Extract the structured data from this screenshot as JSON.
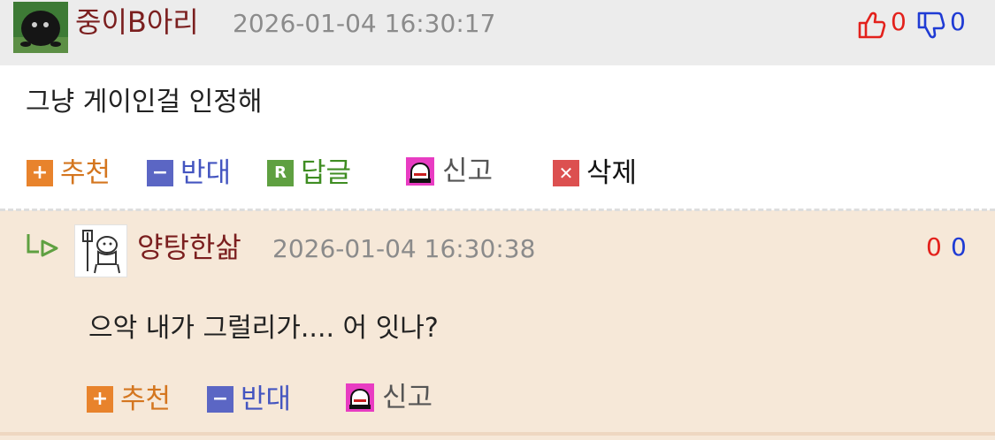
{
  "comment": {
    "username": "중이B아리",
    "timestamp": "2026-01-04 16:30:17",
    "up_count": "0",
    "down_count": "0",
    "text": "그냥 게이인걸 인정해",
    "actions": {
      "recommend": "추천",
      "oppose": "반대",
      "reply": "답글",
      "report": "신고",
      "delete": "삭제"
    },
    "icons": {
      "recommend": "plus-icon",
      "oppose": "minus-icon",
      "reply": "r-icon",
      "report": "alarm-icon",
      "delete": "x-icon"
    }
  },
  "reply": {
    "username": "양탕한삶",
    "timestamp": "2026-01-04 16:30:38",
    "up_count": "0",
    "down_count": "0",
    "text": "으악 내가 그럴리가.... 어 잇나?",
    "actions": {
      "recommend": "추천",
      "oppose": "반대",
      "report": "신고"
    }
  },
  "colors": {
    "header_bg": "#ececec",
    "reply_bg": "#f6e8d8",
    "username": "#7b1f1f",
    "up": "#e3211c",
    "down": "#1f3bd4",
    "recommend": "#e8832c",
    "oppose": "#5b66c4",
    "reply": "#5fa041"
  }
}
